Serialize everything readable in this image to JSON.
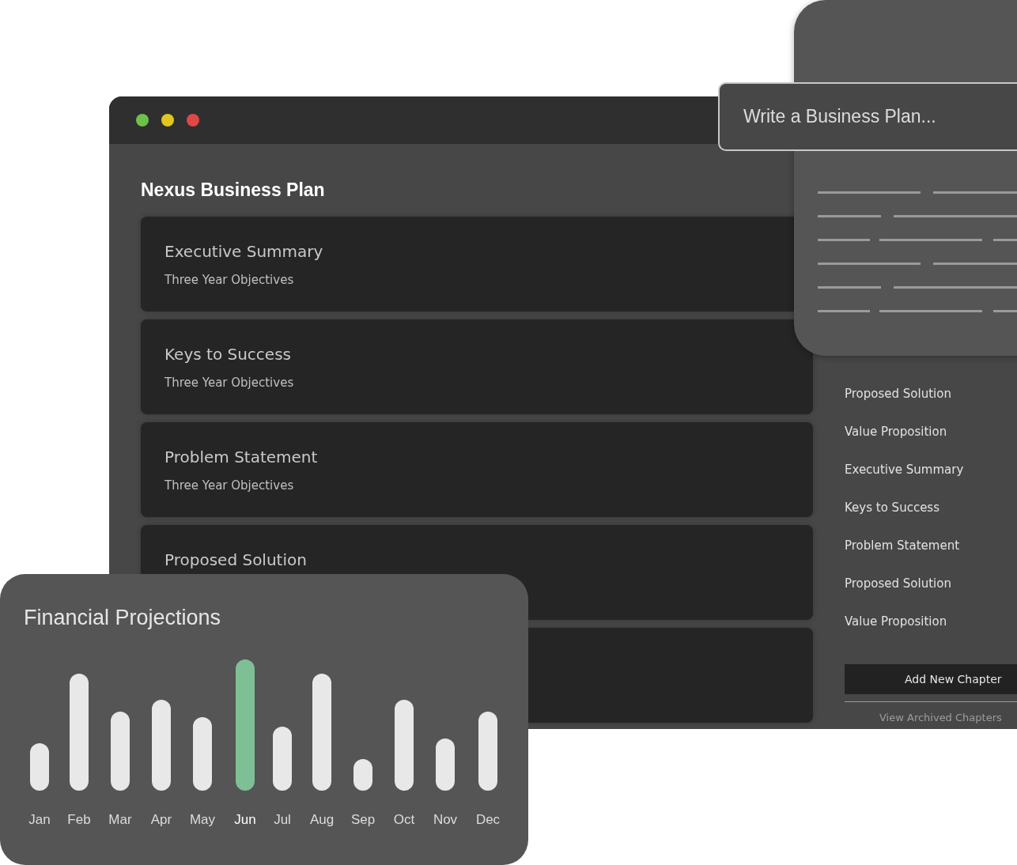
{
  "window": {
    "title": "Nexus Business Plan"
  },
  "sections": [
    {
      "title": "Executive Summary",
      "subtitle": "Three Year Objectives"
    },
    {
      "title": "Keys to Success",
      "subtitle": "Three Year Objectives"
    },
    {
      "title": "Problem Statement",
      "subtitle": "Three Year Objectives"
    },
    {
      "title": "Proposed Solution"
    }
  ],
  "chapters": [
    "Proposed Solution",
    "Value Proposition",
    "Executive Summary",
    "Keys to Success",
    "Problem Statement",
    "Proposed Solution",
    "Value Proposition"
  ],
  "add_button": "Add New Chapter",
  "archive_link": "View Archived Chapters",
  "prompt": {
    "placeholder": "Write a Business Plan..."
  },
  "projections": {
    "title": "Financial Projections",
    "months": [
      {
        "label": "Jan",
        "selected": false
      },
      {
        "label": "Feb",
        "selected": false
      },
      {
        "label": "Mar",
        "selected": false
      },
      {
        "label": "Apr",
        "selected": false
      },
      {
        "label": "May",
        "selected": false
      },
      {
        "label": "Jun",
        "selected": true
      },
      {
        "label": "Jul",
        "selected": false
      },
      {
        "label": "Aug",
        "selected": false
      },
      {
        "label": "Sep",
        "selected": false
      },
      {
        "label": "Oct",
        "selected": false
      },
      {
        "label": "Nov",
        "selected": false
      },
      {
        "label": "Dec",
        "selected": false
      }
    ]
  }
}
